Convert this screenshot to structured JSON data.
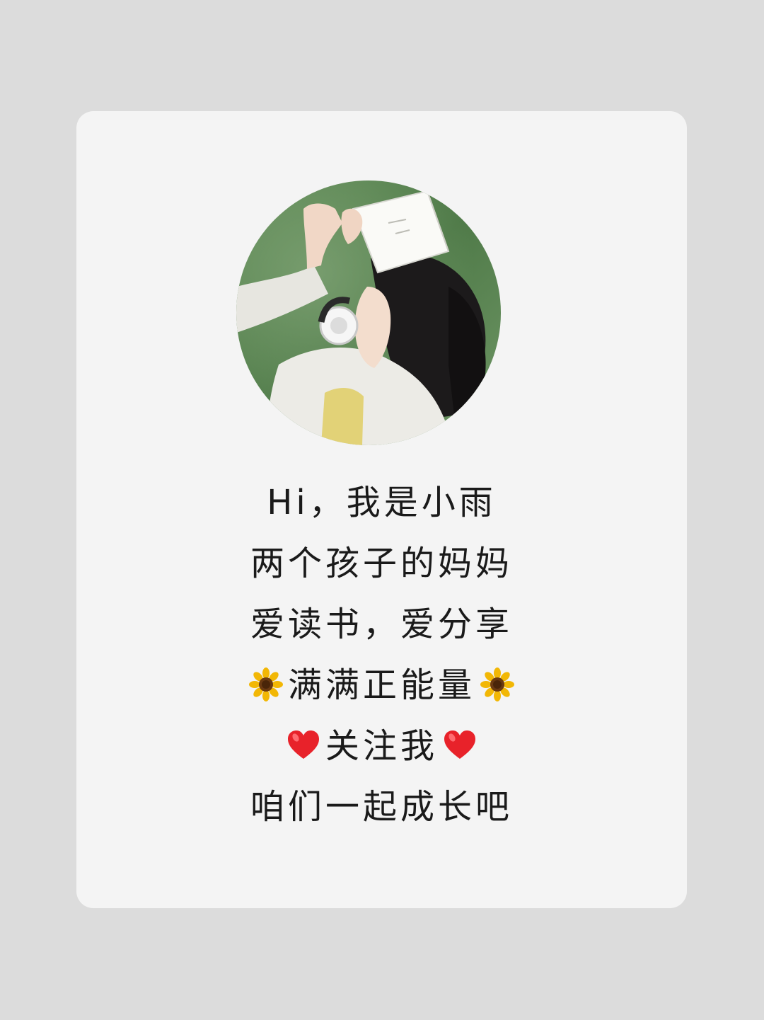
{
  "profile": {
    "avatar_icon": "woman-reading-book-photo",
    "lines": {
      "greeting": "Hi，我是小雨",
      "role": "两个孩子的妈妈",
      "hobbies": "爱读书，爱分享",
      "energy": "满满正能量",
      "follow": "关注我",
      "closing": "咱们一起成长吧"
    }
  },
  "icons": {
    "sunflower": "sunflower-icon",
    "heart": "heart-icon"
  },
  "colors": {
    "background": "#dcdcdc",
    "card": "#f4f4f4",
    "text": "#1a1a1a",
    "heart": "#e8222a",
    "sunflower_petal": "#f2b705",
    "sunflower_center": "#6b3a12"
  }
}
